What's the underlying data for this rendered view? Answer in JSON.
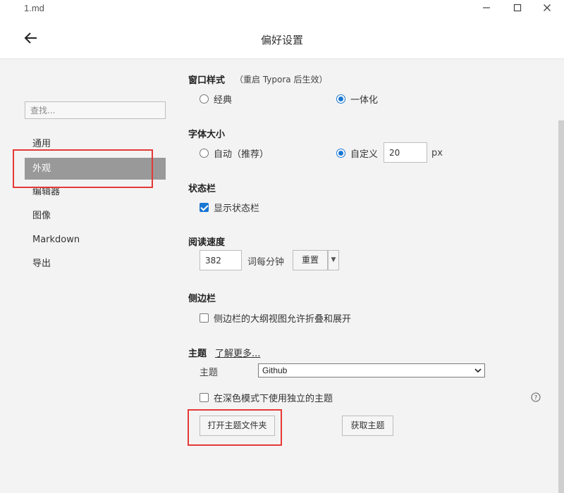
{
  "window": {
    "doc_title": "1.md",
    "minimize_label": "—",
    "maximize_label": "☐",
    "close_label": "✕"
  },
  "header": {
    "title": "偏好设置",
    "back_icon": "back-arrow-icon"
  },
  "sidebar": {
    "search_placeholder": "查找...",
    "items": [
      {
        "label": "通用",
        "active": false
      },
      {
        "label": "外观",
        "active": true
      },
      {
        "label": "编辑器",
        "active": false
      },
      {
        "label": "图像",
        "active": false
      },
      {
        "label": "Markdown",
        "active": false
      },
      {
        "label": "导出",
        "active": false
      }
    ]
  },
  "window_style": {
    "title": "窗口样式",
    "hint": "（重启 Typora 后生效）",
    "options": [
      {
        "label": "经典",
        "selected": false
      },
      {
        "label": "一体化",
        "selected": true
      }
    ]
  },
  "font_size": {
    "title": "字体大小",
    "options": [
      {
        "label": "自动（推荐）",
        "selected": false
      },
      {
        "label": "自定义",
        "selected": true
      }
    ],
    "custom_value": "20",
    "unit": "px"
  },
  "status_bar": {
    "title": "状态栏",
    "show_label": "显示状态栏",
    "checked": true
  },
  "reading_speed": {
    "title": "阅读速度",
    "value": "382",
    "unit_label": "词每分钟",
    "reset_label": "重置",
    "dropdown_icon": "▼"
  },
  "side_panel": {
    "title": "侧边栏",
    "outline_label": "侧边栏的大纲视图允许折叠和展开",
    "checked": false
  },
  "theme": {
    "title": "主题",
    "learn_more": "了解更多...",
    "row_label": "主题",
    "selected": "Github",
    "dark_mode_label": "在深色模式下使用独立的主题",
    "dark_mode_checked": false,
    "open_folder_label": "打开主题文件夹",
    "get_themes_label": "获取主题"
  },
  "colors": {
    "accent": "#1976d2",
    "active_nav": "#999999",
    "highlight_box": "#e53935"
  }
}
